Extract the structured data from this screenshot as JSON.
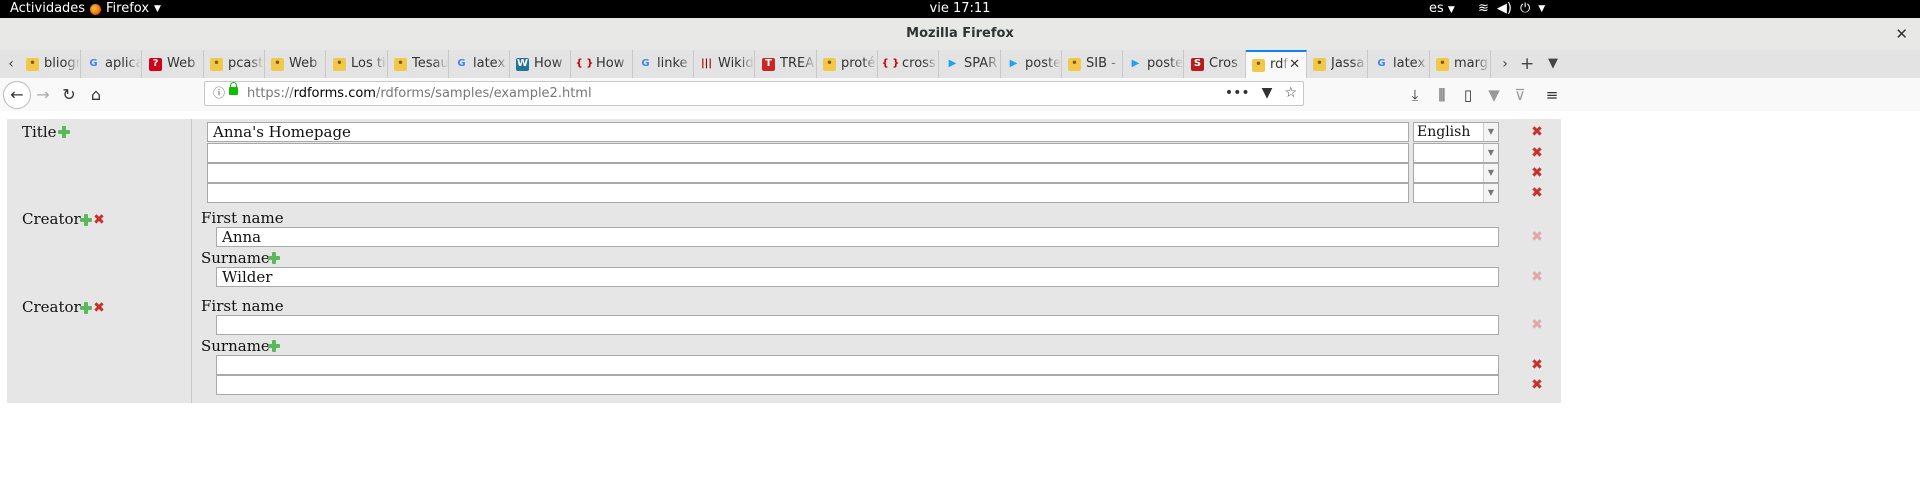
{
  "system_bar": {
    "activities": "Actividades",
    "app": "Firefox",
    "clock": "vie 17:11",
    "language": "es"
  },
  "window": {
    "title": "Mozilla Firefox"
  },
  "tabs": [
    {
      "label": "bliogra",
      "icon": "tab-favicon"
    },
    {
      "label": "aplica",
      "icon": "google-icon"
    },
    {
      "label": "Web",
      "icon": "question-icon"
    },
    {
      "label": "pcast",
      "icon": "tab-favicon"
    },
    {
      "label": "Web",
      "icon": "tab-favicon"
    },
    {
      "label": "Los ti",
      "icon": "tab-favicon"
    },
    {
      "label": "Tesau",
      "icon": "tab-favicon"
    },
    {
      "label": "latex",
      "icon": "google-icon"
    },
    {
      "label": "How",
      "icon": "wordpress-icon"
    },
    {
      "label": "How",
      "icon": "braces-icon"
    },
    {
      "label": "linke",
      "icon": "google-icon"
    },
    {
      "label": "Wikid",
      "icon": "wikidata-icon"
    },
    {
      "label": "TREA",
      "icon": "t-icon"
    },
    {
      "label": "proté",
      "icon": "tab-favicon"
    },
    {
      "label": "cross",
      "icon": "braces-icon"
    },
    {
      "label": "SPAR",
      "icon": "play-icon"
    },
    {
      "label": "poste",
      "icon": "play-icon"
    },
    {
      "label": "SIB -",
      "icon": "tab-favicon"
    },
    {
      "label": "poste",
      "icon": "play-icon"
    },
    {
      "label": "Cros",
      "icon": "s-icon"
    },
    {
      "label": "rdf",
      "icon": "tab-favicon",
      "active": true
    },
    {
      "label": "Jassa",
      "icon": "tab-favicon"
    },
    {
      "label": "latex",
      "icon": "google-icon"
    },
    {
      "label": "marg",
      "icon": "tab-favicon"
    }
  ],
  "urlbar": {
    "scheme": "https://",
    "domain": "rdforms.com",
    "path": "/rdforms/samples/example2.html"
  },
  "form": {
    "title_label": "Title",
    "title_value": "Anna's Homepage",
    "language_value": "English",
    "creator_label": "Creator",
    "first_name_label": "First name",
    "surname_label": "Surname",
    "creator1_first_name": "Anna",
    "creator1_surname": "Wilder",
    "creator2_first_name": "",
    "creator2_surname_1": "",
    "creator2_surname_2": ""
  },
  "colors": {
    "accent": "#0a84ff",
    "add": "#5cb85c",
    "remove": "#c9302c",
    "form_bg": "#e6e6e6"
  }
}
